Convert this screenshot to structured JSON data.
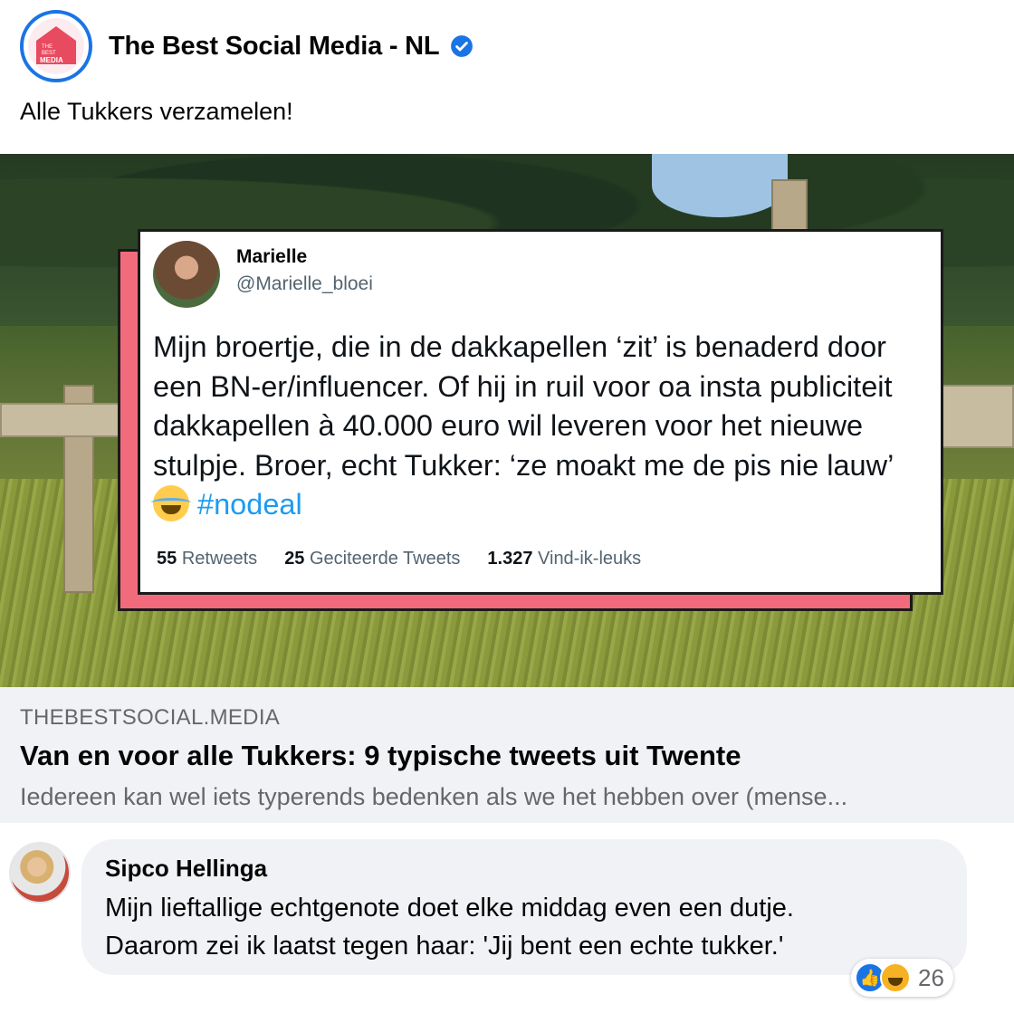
{
  "post": {
    "page_name": "The Best Social Media - NL",
    "avatar_text": "THE BEST SOCIAL MEDIA",
    "text": "Alle Tukkers verzamelen!"
  },
  "tweet": {
    "name": "Marielle",
    "handle": "@Marielle_bloei",
    "body": "Mijn broertje, die in de dakkapellen ‘zit’ is benaderd door een BN-er/influencer. Of hij in ruil voor oa insta publiciteit dakkapellen à 40.000 euro wil leveren voor het nieuwe stulpje. Broer, echt Tukker: ‘ze moakt me de pis nie lauw’",
    "hashtag": "#nodeal",
    "stats": [
      {
        "count": "55",
        "label": "Retweets"
      },
      {
        "count": "25",
        "label": "Geciteerde Tweets"
      },
      {
        "count": "1.327",
        "label": "Vind-ik-leuks"
      }
    ]
  },
  "link": {
    "domain": "THEBESTSOCIAL.MEDIA",
    "title": "Van en voor alle Tukkers: 9 typische tweets uit Twente",
    "description": "Iedereen kan wel iets typerends bedenken als we het hebben over (mense..."
  },
  "comment": {
    "author": "Sipco Hellinga",
    "line1": "Mijn lieftallige echtgenote doet elke middag even een dutje.",
    "line2": "Daarom zei ik laatst tegen haar: 'Jij bent een echte tukker.'",
    "reaction_count": "26"
  },
  "colors": {
    "accent": "#1b74e4",
    "tweet_frame": "#f26b7c",
    "hashtag": "#1d9bf0"
  }
}
